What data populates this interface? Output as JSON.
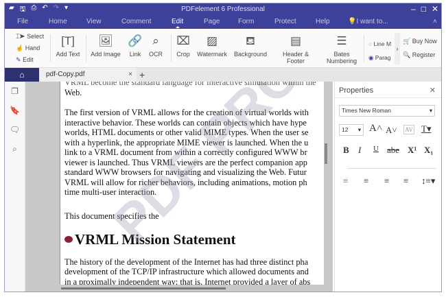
{
  "title": "PDFelement 6 Professional",
  "menu": [
    "File",
    "Home",
    "View",
    "Comment",
    "Edit",
    "Page",
    "Form",
    "Protect",
    "Help"
  ],
  "menu_active": "Edit",
  "iwant": "I want to...",
  "tools": {
    "select": "Select",
    "hand": "Hand",
    "edit": "Edit",
    "add_text": "Add Text",
    "add_image": "Add Image",
    "link": "Link",
    "ocr": "OCR",
    "crop": "Crop",
    "watermark": "Watermark",
    "background": "Background",
    "header_footer": "Header & Footer",
    "bates1": "Bates",
    "bates2": "Numbering",
    "line": "Line M",
    "paragraph": "Parag",
    "buy_now": "Buy Now",
    "register": "Register"
  },
  "tab": {
    "name": "pdf-Copy.pdf"
  },
  "properties": {
    "title": "Properties",
    "font": "Times New Roman",
    "size": "12"
  },
  "doc": {
    "p0": "VRML become the standard language for interactive simulation within the",
    "p0b": "Web.",
    "p1": [
      "The first version of VRML allows for the creation of virtual worlds with",
      "interactive behavior. These worlds can contain objects which have hype",
      "worlds, HTML documents or other valid MIME types. When the user se",
      "with a hyperlink, the appropriate MIME viewer is launched. When the u",
      "link to a VRML document from within a correctly configured WWW br",
      "viewer is launched. Thus VRML viewers are the perfect companion app",
      "standard WWW browsers for navigating and visualizing the Web. Futur",
      "VRML will allow for richer behaviors, including animations, motion ph",
      "time multi-user interaction."
    ],
    "p2": "This document specifies the",
    "heading": "VRML Mission Statement",
    "p3": [
      "The history of the development of the Internet has had three distinct pha",
      "development of the TCP/IP infrastructure which allowed documents and",
      "in a proximally independent way; that is, Internet provided a layer of abs"
    ]
  },
  "watermark": "PDF PRO"
}
